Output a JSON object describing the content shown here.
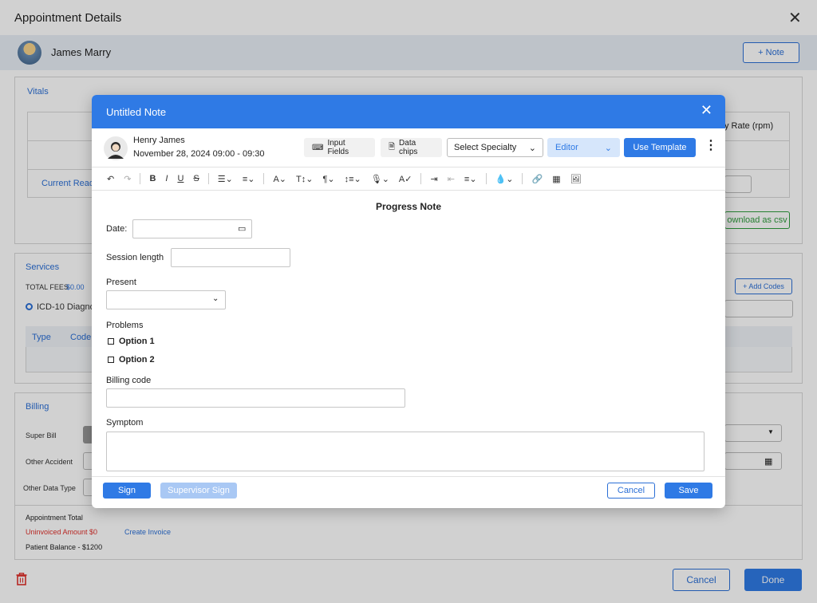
{
  "page": {
    "title": "Appointment Details",
    "patient_name": "James Marry",
    "add_note_label": "+ Note",
    "vitals_title": "Vitals",
    "vitals_rate_header": "y Rate (rpm)",
    "current_reading": "Current Read",
    "download_csv": "ownload as csv",
    "services_title": "Services",
    "total_fees_label": "TOTAL FEES",
    "total_fees_value": "$0.00",
    "add_codes_label": "+ Add Codes",
    "icd_label": "ICD-10 Diagno",
    "col_type": "Type",
    "col_code": "Code",
    "billing_title": "Billing",
    "super_bill": "Super Bill",
    "other_accident": "Other Accident",
    "other_data_type": "Other Data Type",
    "appt_total": "Appointment Total",
    "uninvoiced": "Uninvoiced Amount $0",
    "create_invoice": "Create Invoice",
    "patient_balance": "Patient Balance - $1200",
    "cancel_label": "Cancel",
    "done_label": "Done",
    "colors": {
      "accent": "#2f7ae5",
      "danger": "#e0312d",
      "success": "#2e9b3c"
    }
  },
  "modal": {
    "title": "Untitled Note",
    "provider_name": "Henry James",
    "appointment_time": "November 28, 2024  09:00 - 09:30",
    "input_fields_label": "Input Fields",
    "data_chips_label": "Data chips",
    "specialty_placeholder": "Select Specialty",
    "editor_label": "Editor",
    "use_template_label": "Use Template",
    "form_title": "Progress Note",
    "date_label": "Date:",
    "session_length_label": "Session length",
    "present_label": "Present",
    "problems_label": "Problems",
    "option_1": "Option 1",
    "option_2": "Option 2",
    "billing_code_label": "Billing code",
    "symptom_label": "Symptom",
    "sign_label": "Sign",
    "supervisor_sign_label": "Supervisor Sign",
    "cancel_label": "Cancel",
    "save_label": "Save"
  }
}
